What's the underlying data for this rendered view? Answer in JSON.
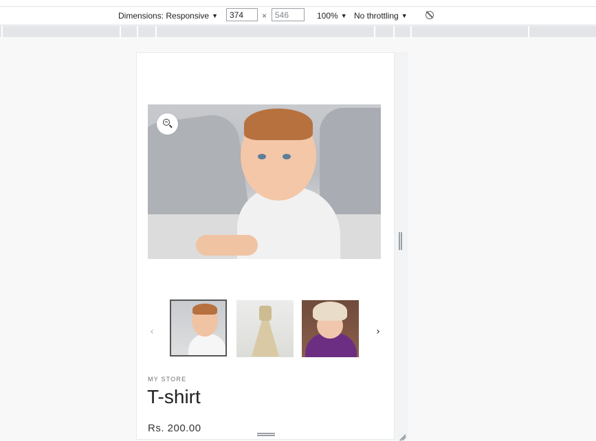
{
  "devtools": {
    "dimensions_label": "Dimensions: Responsive",
    "width_value": "374",
    "times_sign": "×",
    "height_placeholder": "546",
    "zoom_label": "100%",
    "throttling_label": "No throttling",
    "dropdown_caret": "▼",
    "rotate_icon": "rotate-icon"
  },
  "product": {
    "vendor": "MY STORE",
    "title": "T-shirt",
    "price": "Rs. 200.00",
    "main_image": "baby-photo",
    "thumbnails": [
      {
        "name": "baby-photo",
        "active": true
      },
      {
        "name": "dress-photo",
        "active": false
      },
      {
        "name": "girl-photo",
        "active": false
      }
    ],
    "prev_arrow": "‹",
    "next_arrow": "›"
  },
  "colors": {
    "background": "#f7f8f7",
    "viewport": "#ffffff",
    "ruler": "#e4e5e8"
  }
}
